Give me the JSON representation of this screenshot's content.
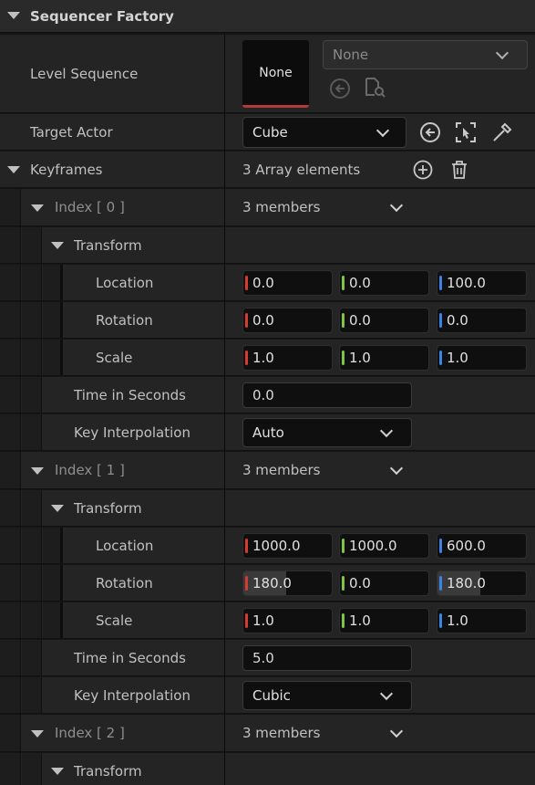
{
  "section_title": "Sequencer Factory",
  "level_sequence": {
    "label": "Level Sequence",
    "thumb_text": "None",
    "combo_value": "None"
  },
  "target_actor": {
    "label": "Target Actor",
    "value": "Cube"
  },
  "keyframes": {
    "label": "Keyframes",
    "summary": "3 Array elements",
    "items": [
      {
        "index_label": "Index [ 0 ]",
        "members": "3 members",
        "transform_label": "Transform",
        "location_label": "Location",
        "location": [
          "0.0",
          "0.0",
          "100.0"
        ],
        "rotation_label": "Rotation",
        "rotation": [
          "0.0",
          "0.0",
          "0.0"
        ],
        "scale_label": "Scale",
        "scale": [
          "1.0",
          "1.0",
          "1.0"
        ],
        "time_label": "Time in Seconds",
        "time": "0.0",
        "interp_label": "Key Interpolation",
        "interp": "Auto"
      },
      {
        "index_label": "Index [ 1 ]",
        "members": "3 members",
        "transform_label": "Transform",
        "location_label": "Location",
        "location": [
          "1000.0",
          "1000.0",
          "600.0"
        ],
        "rotation_label": "Rotation",
        "rotation": [
          "180.0",
          "0.0",
          "180.0"
        ],
        "scale_label": "Scale",
        "scale": [
          "1.0",
          "1.0",
          "1.0"
        ],
        "time_label": "Time in Seconds",
        "time": "5.0",
        "interp_label": "Key Interpolation",
        "interp": "Cubic"
      },
      {
        "index_label": "Index [ 2 ]",
        "members": "3 members",
        "transform_label": "Transform"
      }
    ]
  },
  "colors": {
    "x_axis": "#d63b2f",
    "y_axis": "#7fc640",
    "z_axis": "#3b82e6",
    "background": "#151515",
    "row": "#242424"
  }
}
